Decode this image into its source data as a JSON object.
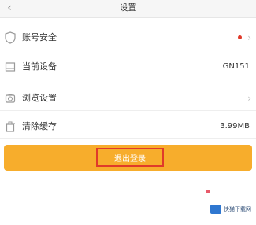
{
  "header": {
    "back_icon": "chevron-left-icon",
    "title": "设置"
  },
  "rows": [
    {
      "icon": "shield-icon",
      "label": "账号安全",
      "value": "",
      "has_dot": true,
      "has_chevron": true
    },
    {
      "icon": "device-icon",
      "label": "当前设备",
      "value": "GN151",
      "has_dot": false,
      "has_chevron": false
    },
    {
      "icon": "camera-icon",
      "label": "浏览设置",
      "value": "",
      "has_dot": false,
      "has_chevron": true
    },
    {
      "icon": "trash-icon",
      "label": "清除缓存",
      "value": "3.99MB",
      "has_dot": false,
      "has_chevron": false
    }
  ],
  "button": {
    "label": "退出登录"
  },
  "watermark": {
    "text": "快猫下载网"
  },
  "colors": {
    "accent": "#f7ad2c",
    "highlight_border": "#e03a2a",
    "dot": "#e03a2a"
  }
}
